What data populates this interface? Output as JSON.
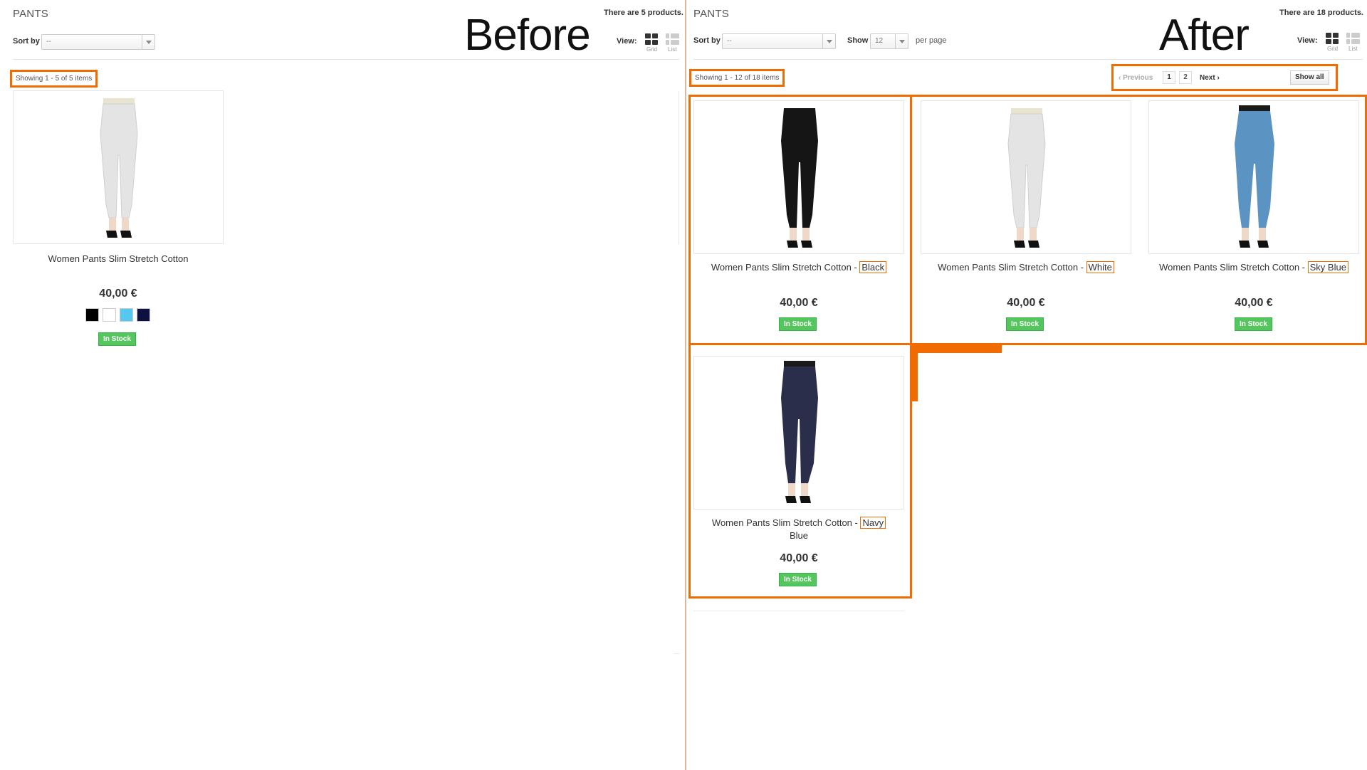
{
  "colors": {
    "highlight": "#f06c00",
    "stock_green": "#55c65e",
    "split": "#d9b999"
  },
  "before": {
    "big_label": "Before",
    "category": "PANTS",
    "product_count": "There are 5 products.",
    "sort_label": "Sort by",
    "sort_value": "--",
    "view_label": "View:",
    "view_grid": "Grid",
    "view_list": "List",
    "showing": "Showing 1 - 5 of 5 items",
    "product": {
      "name": "Women Pants Slim Stretch Cotton",
      "price": "40,00 €",
      "stock": "In Stock",
      "swatches": [
        "#000000",
        "#ffffff",
        "#56c8f0",
        "#0d1040"
      ]
    }
  },
  "after": {
    "big_label": "After",
    "category": "PANTS",
    "product_count": "There are 18 products.",
    "sort_label": "Sort by",
    "sort_value": "--",
    "show_label": "Show",
    "show_value": "12",
    "per_page": "per page",
    "view_label": "View:",
    "view_grid": "Grid",
    "view_list": "List",
    "showing": "Showing 1 - 12 of 18 items",
    "pagination": {
      "previous": "Previous",
      "pages": [
        "1",
        "2"
      ],
      "next": "Next",
      "show_all": "Show all"
    },
    "products": [
      {
        "name": "Women Pants Slim Stretch Cotton - ",
        "color": "Black",
        "price": "40,00 €",
        "stock": "In Stock",
        "pants_color": "#151515"
      },
      {
        "name": "Women Pants Slim Stretch Cotton - ",
        "color": "White",
        "price": "40,00 €",
        "stock": "In Stock",
        "pants_color": "#e4e4e4"
      },
      {
        "name": "Women Pants Slim Stretch Cotton - ",
        "color": "Sky Blue",
        "price": "40,00 €",
        "stock": "In Stock",
        "pants_color": "#5b93c3"
      },
      {
        "name": "Women Pants Slim Stretch Cotton - ",
        "color": "Navy",
        "name_tail": "Blue",
        "price": "40,00 €",
        "stock": "In Stock",
        "pants_color": "#2a2e4a"
      }
    ]
  }
}
